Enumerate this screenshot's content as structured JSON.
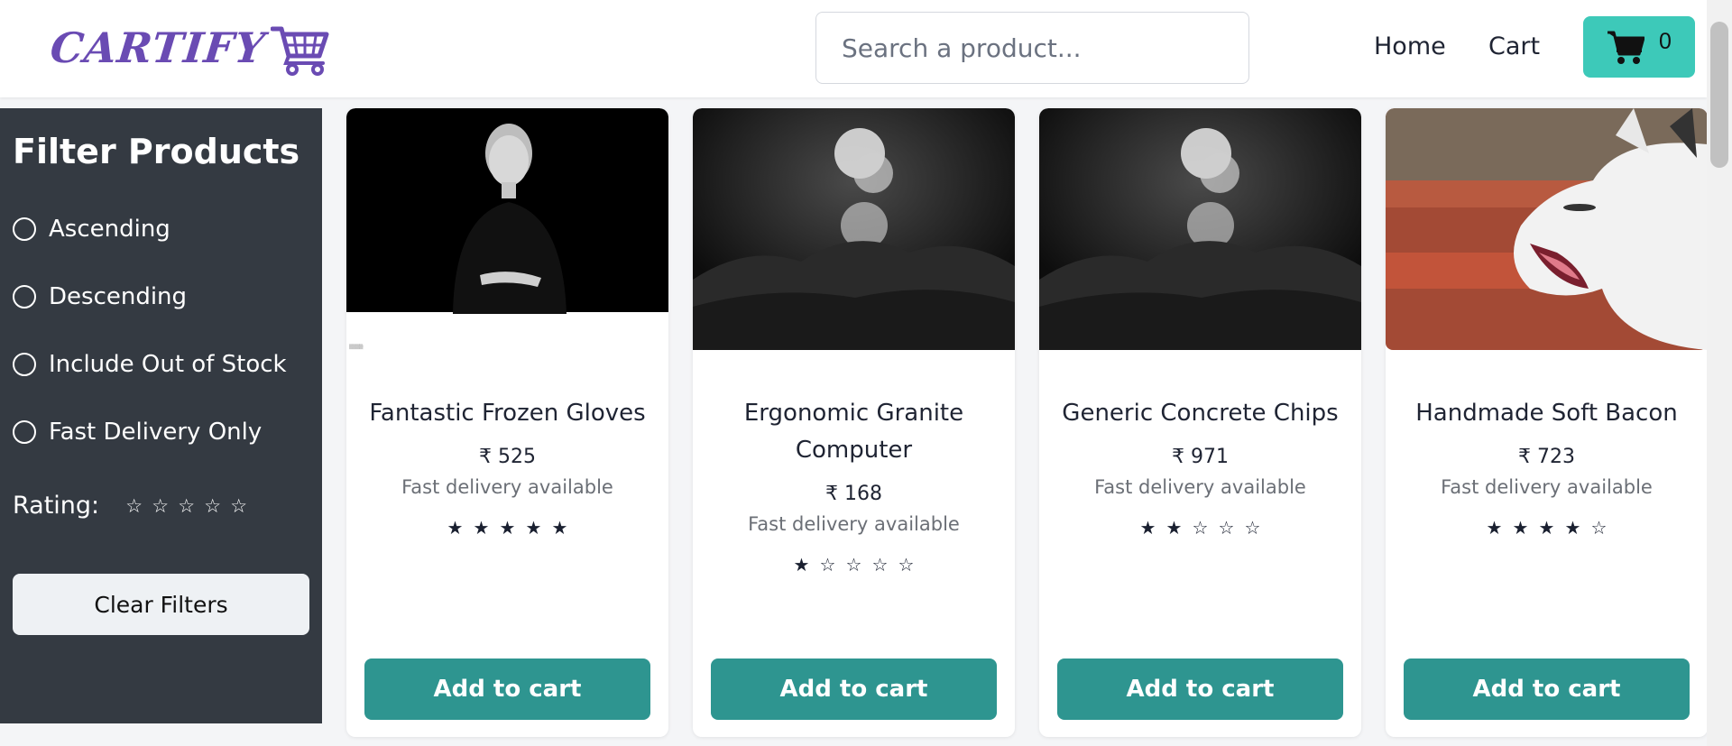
{
  "header": {
    "logo_text": "CARTIFY",
    "search_placeholder": "Search a product...",
    "nav": {
      "home": "Home",
      "cart": "Cart"
    },
    "cart_count": "0"
  },
  "sidebar": {
    "title": "Filter Products",
    "options": [
      "Ascending",
      "Descending",
      "Include Out of Stock",
      "Fast Delivery Only"
    ],
    "rating_label": "Rating:",
    "rating_value": 0,
    "rating_max": 5,
    "clear_label": "Clear Filters"
  },
  "products": [
    {
      "name": "Fantastic Frozen Gloves",
      "price": "₹ 525",
      "delivery": "Fast delivery available",
      "rating": 5,
      "button": "Add to cart"
    },
    {
      "name": "Ergonomic Granite Computer",
      "price": "₹ 168",
      "delivery": "Fast delivery available",
      "rating": 1,
      "button": "Add to cart"
    },
    {
      "name": "Generic Concrete Chips",
      "price": "₹ 971",
      "delivery": "Fast delivery available",
      "rating": 2,
      "button": "Add to cart"
    },
    {
      "name": "Handmade Soft Bacon",
      "price": "₹ 723",
      "delivery": "Fast delivery available",
      "rating": 4,
      "button": "Add to cart"
    }
  ],
  "colors": {
    "brand": "#6a4bb3",
    "cart_button": "#3dc9b9",
    "add_to_cart": "#2e9590",
    "sidebar_bg": "#343a42"
  }
}
